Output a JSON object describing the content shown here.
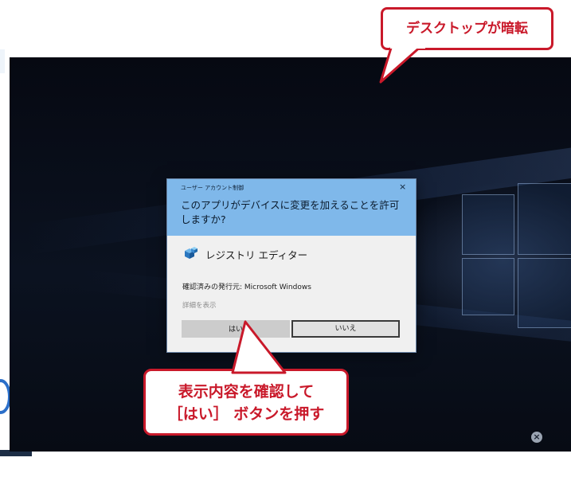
{
  "dialog": {
    "title": "ユーザー アカウント制御",
    "close_glyph": "×",
    "question": "このアプリがデバイスに変更を加えることを許可しますか?",
    "app_name": "レジストリ エディター",
    "publisher": "確認済みの発行元: Microsoft Windows",
    "details_link": "詳細を表示",
    "yes_label": "はい",
    "no_label": "いいえ"
  },
  "callouts": {
    "top": "デスクトップが暗転",
    "bottom_line1": "表示内容を確認して",
    "bottom_line2": "［はい］ ボタンを押す"
  },
  "desktop": {
    "close_glyph": "×"
  },
  "colors": {
    "callout_red": "#c9192a",
    "dialog_header": "#7fb8ea",
    "desktop_bg": "#0b1220"
  }
}
